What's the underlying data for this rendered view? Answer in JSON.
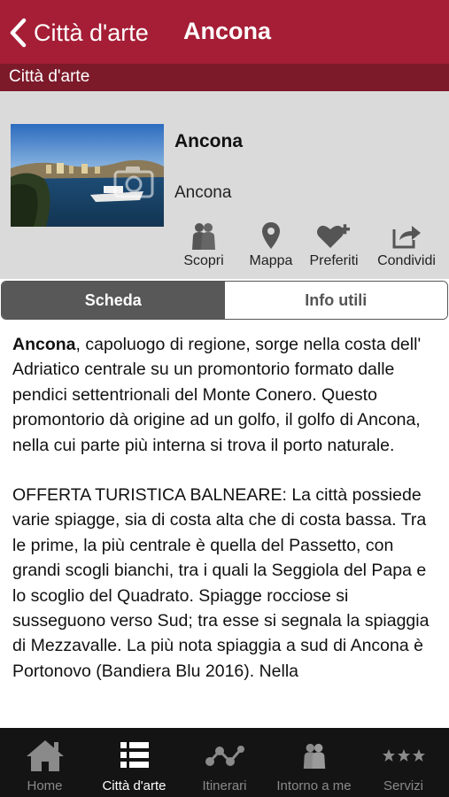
{
  "header": {
    "back_label": "Città d'arte",
    "title": "Ancona",
    "section": "Città d'arte"
  },
  "place": {
    "title": "Ancona",
    "subtitle": "Ancona",
    "image_icon": "camera-icon"
  },
  "actions": [
    {
      "label": "Scopri",
      "icon": "people-icon"
    },
    {
      "label": "Mappa",
      "icon": "map-pin-icon"
    },
    {
      "label": "Preferiti",
      "icon": "heart-plus-icon"
    },
    {
      "label": "Condividi",
      "icon": "share-icon"
    }
  ],
  "tabs_segment": {
    "active": "Scheda",
    "inactive": "Info utili"
  },
  "article": {
    "lead": "Ancona",
    "p1": ", capoluogo di regione, sorge nella costa dell' Adriatico centrale su un promontorio formato dalle pendici settentrionali del Monte Conero. Questo promontorio dà origine ad un golfo, il golfo di Ancona, nella cui parte più interna si trova il porto naturale.",
    "p2": "OFFERTA TURISTICA BALNEARE: La città possiede varie spiagge, sia di costa alta che di costa bassa. Tra le prime, la più centrale è quella del Passetto, con grandi scogli bianchi, tra i quali la Seggiola del Papa e lo scoglio del Quadrato. Spiagge rocciose si susseguono verso Sud; tra esse si segnala la spiaggia di Mezzavalle. La più nota spiaggia a sud di Ancona è Portonovo (Bandiera Blu 2016). Nella"
  },
  "tabbar": [
    {
      "label": "Home",
      "icon": "home-icon",
      "active": false
    },
    {
      "label": "Città d'arte",
      "icon": "list-icon",
      "active": true
    },
    {
      "label": "Itinerari",
      "icon": "route-icon",
      "active": false
    },
    {
      "label": "Intorno a me",
      "icon": "people-icon",
      "active": false
    },
    {
      "label": "Servizi",
      "icon": "stars-icon",
      "active": false
    }
  ],
  "colors": {
    "header": "#a51e36",
    "section_bar": "#7c1a2a",
    "info_bg": "#dadada",
    "segment_active": "#585858",
    "tabbar": "#141414"
  }
}
